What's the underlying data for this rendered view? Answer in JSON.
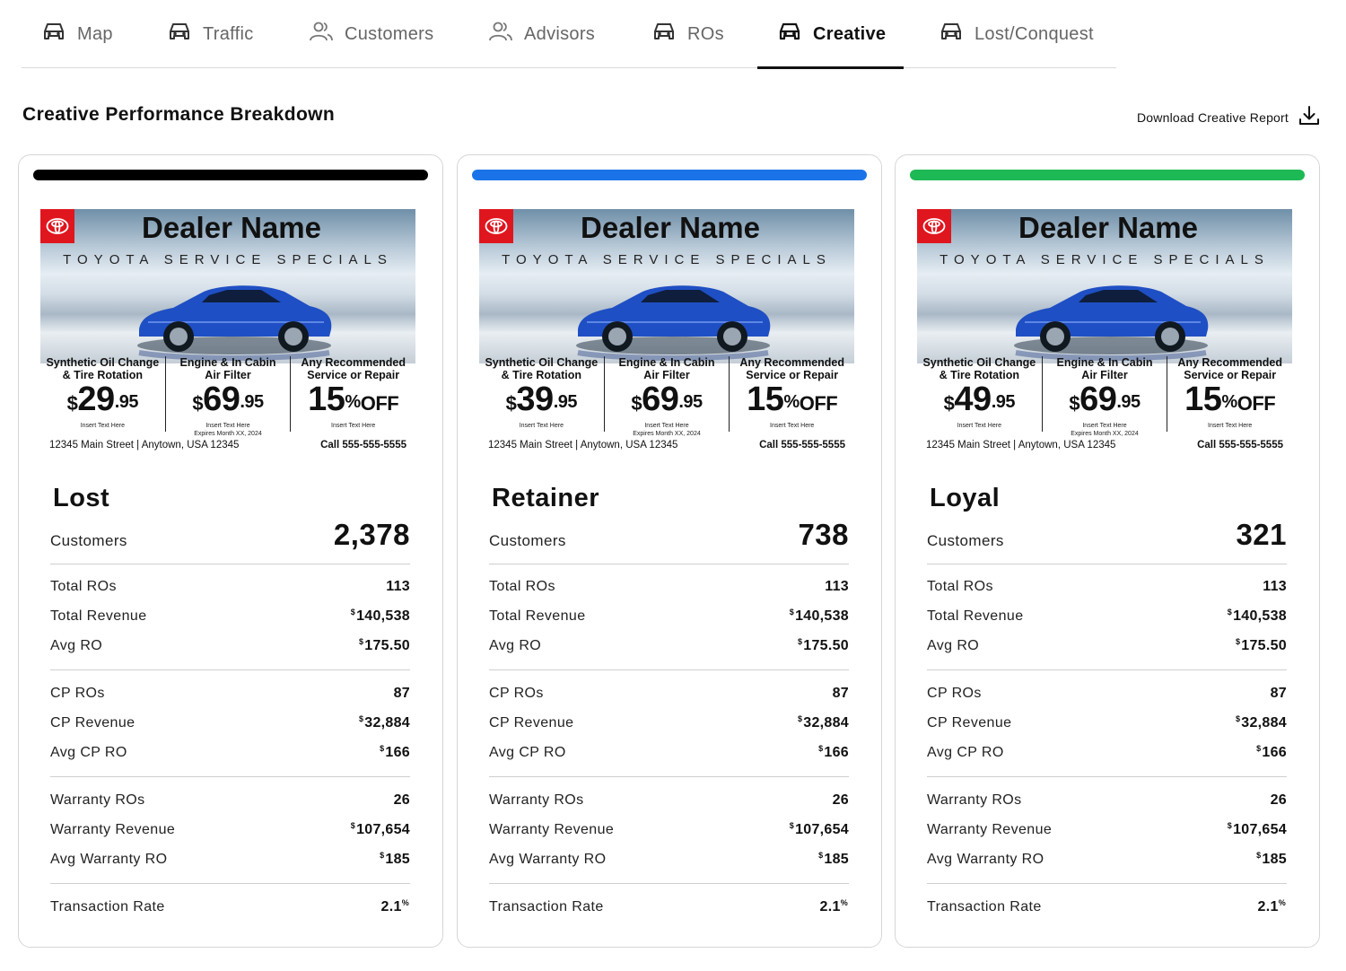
{
  "tabs": [
    {
      "label": "Map",
      "icon": "car-icon"
    },
    {
      "label": "Traffic",
      "icon": "car-icon"
    },
    {
      "label": "Customers",
      "icon": "users-icon"
    },
    {
      "label": "Advisors",
      "icon": "users-icon"
    },
    {
      "label": "ROs",
      "icon": "car-icon"
    },
    {
      "label": "Creative",
      "icon": "car-icon",
      "active": true
    },
    {
      "label": "Lost/Conquest",
      "icon": "car-icon"
    }
  ],
  "header": {
    "title": "Creative Performance Breakdown",
    "download_label": "Download Creative Report"
  },
  "ad": {
    "dealer": "Dealer Name",
    "subtitle": "TOYOTA SERVICE SPECIALS",
    "offer2_title": "Engine & In Cabin\nAir Filter",
    "offer2_price_main": "69",
    "offer2_price_cents": ".95",
    "offer3_title": "Any Recommended\nService or Repair",
    "offer3_value": "15",
    "offer3_pct": "%",
    "offer3_off": "OFF",
    "offer1_title": "Synthetic Oil Change\n& Tire Rotation",
    "insert_text": "Insert Text Here",
    "expires": "Expires Month XX, 2024",
    "address": "12345 Main Street | Anytown, USA 12345",
    "phone": "Call 555-555-5555",
    "currency": "$"
  },
  "cards": [
    {
      "segment": "Lost",
      "bar_color": "#000000",
      "offer1_price_main": "29",
      "offer1_price_cents": ".95",
      "customers_label": "Customers",
      "customers": "2,378",
      "total_ros_label": "Total ROs",
      "total_ros": "113",
      "total_revenue_label": "Total Revenue",
      "total_revenue": "140,538",
      "avg_ro_label": "Avg RO",
      "avg_ro": "175.50",
      "cp_ros_label": "CP ROs",
      "cp_ros": "87",
      "cp_revenue_label": "CP Revenue",
      "cp_revenue": "32,884",
      "avg_cp_ro_label": "Avg CP RO",
      "avg_cp_ro": "166",
      "warranty_ros_label": "Warranty ROs",
      "warranty_ros": "26",
      "warranty_revenue_label": "Warranty Revenue",
      "warranty_revenue": "107,654",
      "avg_warranty_ro_label": "Avg Warranty RO",
      "avg_warranty_ro": "185",
      "transaction_rate_label": "Transaction Rate",
      "transaction_rate": "2.1"
    },
    {
      "segment": "Retainer",
      "bar_color": "#1a73e8",
      "offer1_price_main": "39",
      "offer1_price_cents": ".95",
      "customers_label": "Customers",
      "customers": "738",
      "total_ros_label": "Total ROs",
      "total_ros": "113",
      "total_revenue_label": "Total Revenue",
      "total_revenue": "140,538",
      "avg_ro_label": "Avg RO",
      "avg_ro": "175.50",
      "cp_ros_label": "CP ROs",
      "cp_ros": "87",
      "cp_revenue_label": "CP Revenue",
      "cp_revenue": "32,884",
      "avg_cp_ro_label": "Avg CP RO",
      "avg_cp_ro": "166",
      "warranty_ros_label": "Warranty ROs",
      "warranty_ros": "26",
      "warranty_revenue_label": "Warranty Revenue",
      "warranty_revenue": "107,654",
      "avg_warranty_ro_label": "Avg Warranty RO",
      "avg_warranty_ro": "185",
      "transaction_rate_label": "Transaction Rate",
      "transaction_rate": "2.1"
    },
    {
      "segment": "Loyal",
      "bar_color": "#1db954",
      "offer1_price_main": "49",
      "offer1_price_cents": ".95",
      "customers_label": "Customers",
      "customers": "321",
      "total_ros_label": "Total ROs",
      "total_ros": "113",
      "total_revenue_label": "Total Revenue",
      "total_revenue": "140,538",
      "avg_ro_label": "Avg RO",
      "avg_ro": "175.50",
      "cp_ros_label": "CP ROs",
      "cp_ros": "87",
      "cp_revenue_label": "CP Revenue",
      "cp_revenue": "32,884",
      "avg_cp_ro_label": "Avg CP RO",
      "avg_cp_ro": "166",
      "warranty_ros_label": "Warranty ROs",
      "warranty_ros": "26",
      "warranty_revenue_label": "Warranty Revenue",
      "warranty_revenue": "107,654",
      "avg_warranty_ro_label": "Avg Warranty RO",
      "avg_warranty_ro": "185",
      "transaction_rate_label": "Transaction Rate",
      "transaction_rate": "2.1"
    }
  ],
  "units": {
    "currency": "$",
    "percent": "%"
  }
}
